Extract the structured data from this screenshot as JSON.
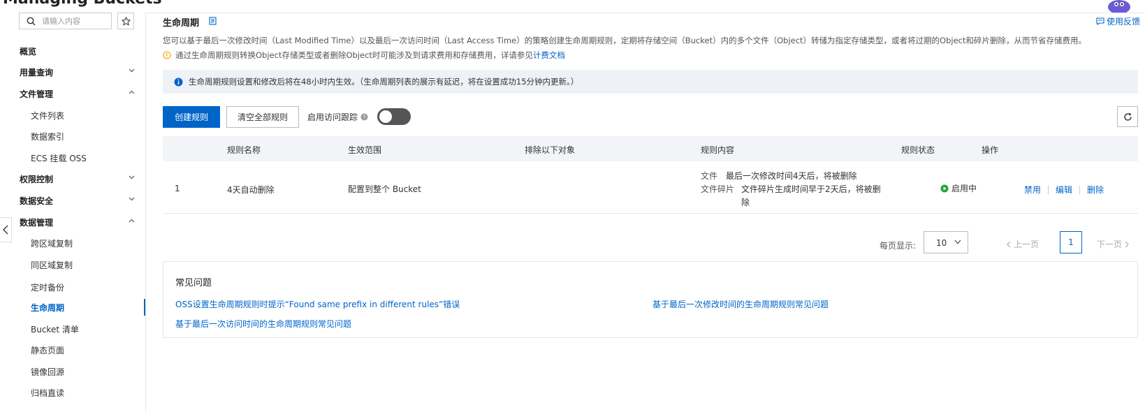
{
  "header": {
    "title_fragment": "Managing Buckets"
  },
  "sidebar": {
    "search_placeholder": "请输入内容",
    "items": [
      {
        "label": "概览"
      },
      {
        "label": "用量查询"
      },
      {
        "label": "文件管理"
      },
      {
        "label": "文件列表"
      },
      {
        "label": "数据索引"
      },
      {
        "label": "ECS 挂载 OSS"
      },
      {
        "label": "权限控制"
      },
      {
        "label": "数据安全"
      },
      {
        "label": "数据管理"
      },
      {
        "label": "跨区域复制"
      },
      {
        "label": "同区域复制"
      },
      {
        "label": "定时备份"
      },
      {
        "label": "生命周期"
      },
      {
        "label": "Bucket 清单"
      },
      {
        "label": "静态页面"
      },
      {
        "label": "镜像回源"
      },
      {
        "label": "归档直读"
      }
    ]
  },
  "main": {
    "page_title": "生命周期",
    "help_link": "使用反馈",
    "description": "您可以基于最后一次修改时间（Last Modified Time）以及最后一次访问时间（Last Access Time）的策略创建生命周期规则，定期将存储空间（Bucket）内的多个文件（Object）转储为指定存储类型，或者将过期的Object和碎片删除，从而节省存储费用。",
    "warning_text": "通过生命周期规则转换Object存储类型或者删除Object时可能涉及到请求费用和存储费用，详请参见",
    "warning_link": "计费文档",
    "notice": "生命周期规则设置和修改后将在48小时内生效。（生命周期列表的展示有延迟，将在设置成功15分钟内更新。）",
    "create_button": "创建规则",
    "clear_button": "清空全部规则",
    "toggle_label": "启用访问跟踪",
    "table": {
      "headers": [
        "规则名称",
        "生效范围",
        "排除以下对象",
        "规则内容",
        "规则状态",
        "操作"
      ],
      "rows": [
        {
          "index": "1",
          "name": "4天自动删除",
          "scope": "配置到整个 Bucket",
          "exclude": "",
          "content_file_key": "文件",
          "content_file_val": "最后一次修改时间4天后，将被删除",
          "content_frag_key": "文件碎片",
          "content_frag_val1": "文件碎片生成时间早于2天后，将被删",
          "content_frag_val2": "除",
          "status": "启用中",
          "ops": [
            "禁用",
            "编辑",
            "删除"
          ]
        }
      ]
    },
    "pager": {
      "label": "每页显示:",
      "page_size": "10",
      "prev": "上一页",
      "current": "1",
      "next": "下一页"
    },
    "faq": {
      "title": "常见问题",
      "links": [
        "OSS设置生命周期规则时提示“Found same prefix in different rules”错误",
        "基于最后一次修改时间的生命周期规则常见问题",
        "基于最后一次访问时间的生命周期规则常见问题"
      ]
    }
  },
  "colors": {
    "accent": "#0064c8",
    "status_ok": "#21a336",
    "notice_bg": "#eef2f7",
    "warn": "#f0a400"
  }
}
